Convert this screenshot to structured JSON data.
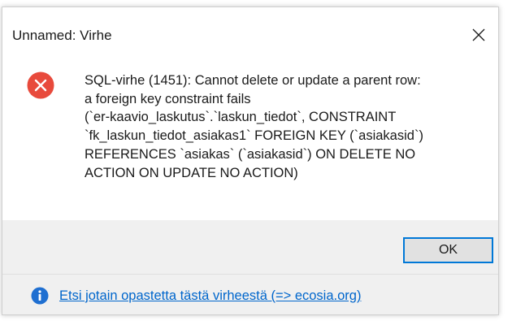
{
  "window": {
    "title": "Unnamed: Virhe",
    "close_icon": "close-icon"
  },
  "content": {
    "icon": "error-icon",
    "message": "SQL-virhe (1451): Cannot delete or update a parent row:\na foreign key constraint fails\n(`er-kaavio_laskutus`.`laskun_tiedot`, CONSTRAINT\n`fk_laskun_tiedot_asiakas1` FOREIGN KEY (`asiakasid`)\nREFERENCES `asiakas` (`asiakasid`) ON DELETE NO\nACTION ON UPDATE NO ACTION)"
  },
  "buttons": {
    "ok_label": "OK"
  },
  "footer": {
    "icon": "info-icon",
    "link_text": "Etsi jotain opastetta tästä virheestä (=> ecosia.org)"
  },
  "colors": {
    "error_red": "#e84a3c",
    "info_blue": "#1f6fd1",
    "link_blue": "#0066cc",
    "button_border": "#0078d7",
    "button_bg": "#e1e1e1",
    "panel_bg": "#f0f0f0"
  }
}
